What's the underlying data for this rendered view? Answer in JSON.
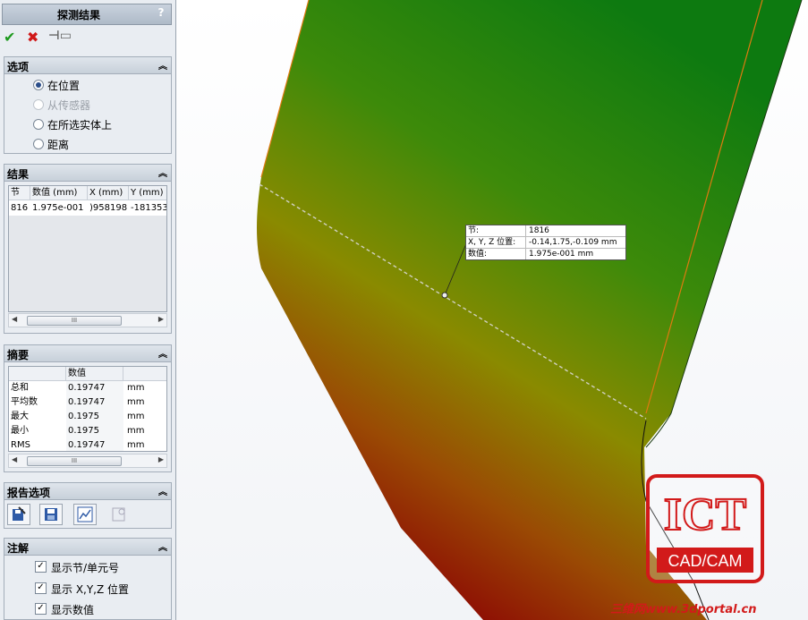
{
  "panel": {
    "title": "探测结果",
    "help": "?",
    "ok_icon": "check-icon",
    "cancel_icon": "x-icon",
    "pin_icon": "pushpin-icon"
  },
  "options": {
    "title": "选项",
    "items": [
      {
        "label": "在位置",
        "selected": true,
        "enabled": true
      },
      {
        "label": "从传感器",
        "selected": false,
        "enabled": false
      },
      {
        "label": "在所选实体上",
        "selected": false,
        "enabled": true
      },
      {
        "label": "距离",
        "selected": false,
        "enabled": true
      }
    ]
  },
  "results": {
    "title": "结果",
    "headers": [
      "节",
      "数值 (mm)",
      "X (mm)",
      "Y (mm)"
    ],
    "rows": [
      [
        "816",
        "1.975e-001",
        ")958198",
        "-181353"
      ]
    ]
  },
  "summary": {
    "title": "摘要",
    "header": "数值",
    "rows": [
      {
        "name": "总和",
        "value": "0.19747",
        "unit": "mm"
      },
      {
        "name": "平均数",
        "value": "0.19747",
        "unit": "mm"
      },
      {
        "name": "最大",
        "value": "0.1975",
        "unit": "mm"
      },
      {
        "name": "最小",
        "value": "0.1975",
        "unit": "mm"
      },
      {
        "name": "RMS",
        "value": "0.19747",
        "unit": "mm"
      }
    ]
  },
  "report": {
    "title": "报告选项",
    "buttons": [
      "save-report-icon",
      "save-file-icon",
      "plot-icon",
      "sensor-icon"
    ]
  },
  "annotation": {
    "title": "注解",
    "items": [
      {
        "label": "显示节/单元号",
        "checked": true
      },
      {
        "label": "显示 X,Y,Z 位置",
        "checked": true
      },
      {
        "label": "显示数值",
        "checked": true
      }
    ]
  },
  "scroll_glyph": "III",
  "tooltip": {
    "rows": [
      {
        "key": "节:",
        "value": "1816"
      },
      {
        "key": "X, Y, Z 位置:",
        "value": "-0.14,1.75,-0.109 mm"
      },
      {
        "key": "数值:",
        "value": "1.975e-001 mm"
      }
    ]
  },
  "logo": {
    "big": "ICT",
    "small": "CAD/CAM"
  },
  "watermark": "三维网www.3dportal.cn",
  "colors": {
    "hot": "#b40f0f",
    "mid": "#8f8a00",
    "cool": "#1a8a14",
    "accent": "#d21a1a"
  }
}
